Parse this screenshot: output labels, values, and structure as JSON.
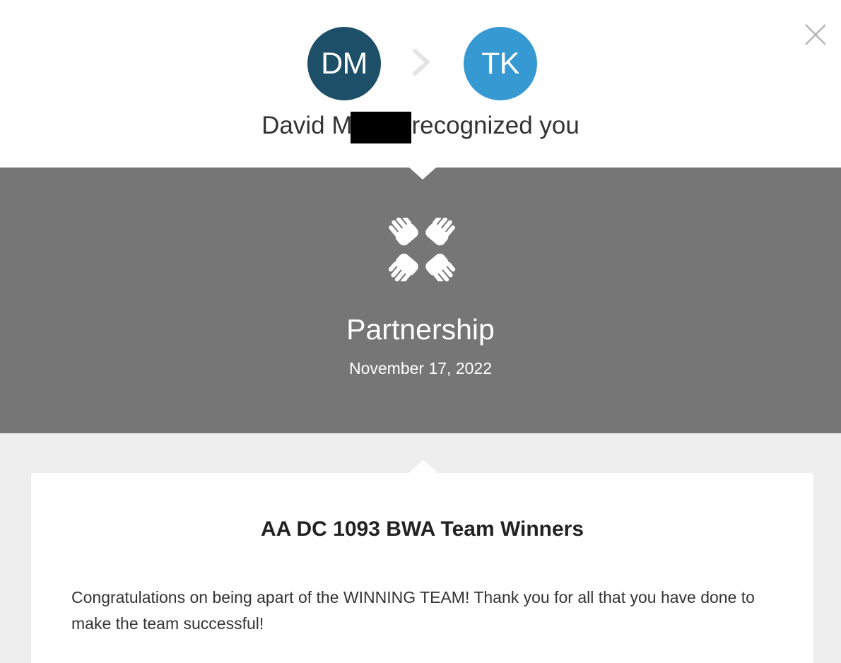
{
  "header": {
    "close_label": "×",
    "from_avatar": {
      "initials": "DM",
      "color": "#1d4f68"
    },
    "to_avatar": {
      "initials": "TK",
      "color": "#3799d1"
    },
    "sender_name": "David M",
    "recognition_text": "recognized you",
    "icons": {
      "close": "close-icon",
      "arrow": "chevron-right-icon"
    }
  },
  "band": {
    "background": "#767676",
    "icon": "partnership-hands-icon",
    "value_title": "Partnership",
    "date": "November 17, 2022"
  },
  "card": {
    "title": "AA DC 1093 BWA Team Winners",
    "message": "Congratulations on being apart of the WINNING TEAM! Thank you for all that you have done to make the team successful!"
  },
  "colors": {
    "page_bg": "#ffffff",
    "lower_bg": "#eeeeee",
    "close_icon": "#b5b5b5",
    "chevron": "#e4e4e4"
  }
}
